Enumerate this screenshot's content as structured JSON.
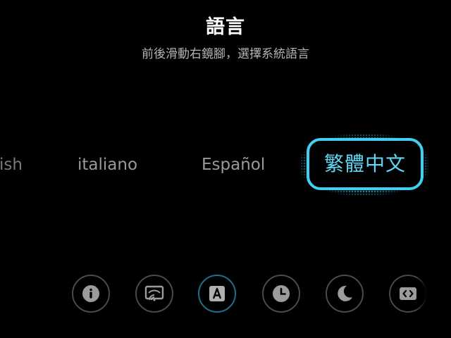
{
  "header": {
    "title": "語言",
    "subtitle": "前後滑動右鏡腳，選擇系統語言"
  },
  "languages": {
    "previous_partial": "English",
    "items": [
      "italiano",
      "Español"
    ],
    "selected": "繁體中文"
  },
  "toolbar": {
    "icons": [
      {
        "name": "info-icon",
        "active": false
      },
      {
        "name": "screen-cast-icon",
        "active": false
      },
      {
        "name": "language-icon",
        "active": true
      },
      {
        "name": "clock-icon",
        "active": false
      },
      {
        "name": "moon-icon",
        "active": false
      },
      {
        "name": "code-icon",
        "active": false
      }
    ]
  },
  "colors": {
    "background": "#000000",
    "accent": "#3fd0f2",
    "text_primary": "#ffffff",
    "text_secondary": "#b4b4b4",
    "text_inactive": "#9a9a9a",
    "icon_border": "#4a4a4a",
    "icon_active_border": "#1f6f86"
  }
}
